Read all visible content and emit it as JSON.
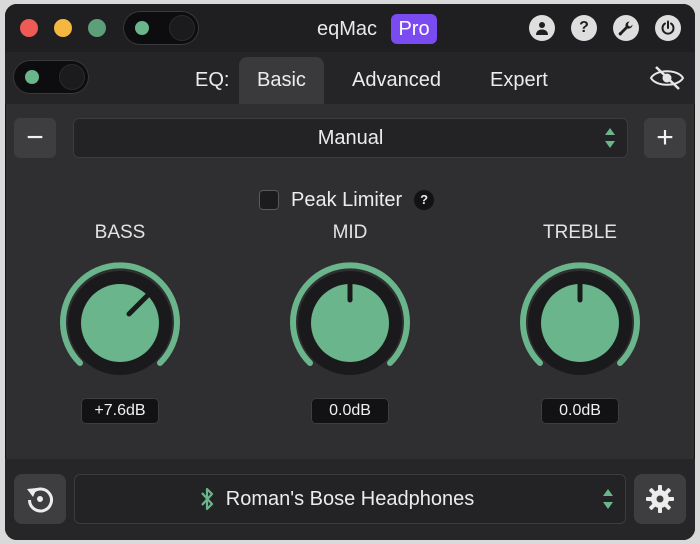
{
  "window": {
    "title": "eqMac",
    "badge": "Pro"
  },
  "titlebar": {
    "icons": [
      "user-icon",
      "question-icon",
      "wrench-icon",
      "power-icon"
    ],
    "help_label": "?"
  },
  "tabs": {
    "eq_label": "EQ:",
    "items": [
      {
        "label": "Basic",
        "active": true
      },
      {
        "label": "Advanced",
        "active": false
      },
      {
        "label": "Expert",
        "active": false
      }
    ]
  },
  "preset": {
    "remove_label": "−",
    "selected": "Manual",
    "add_label": "+"
  },
  "peak_limiter": {
    "label": "Peak Limiter",
    "checked": false,
    "help_label": "?"
  },
  "knobs": [
    {
      "name": "BASS",
      "value_label": "+7.6dB",
      "value_db": 7.6
    },
    {
      "name": "MID",
      "value_label": "0.0dB",
      "value_db": 0.0
    },
    {
      "name": "TREBLE",
      "value_label": "0.0dB",
      "value_db": 0.0
    }
  ],
  "output": {
    "device": "Roman's Bose Headphones",
    "icon": "bluetooth-icon"
  },
  "colors": {
    "accent": "#6ab58b",
    "pro_badge": "#7a4bf1",
    "close": "#ee5b56",
    "minimize": "#f4b841",
    "maximize": "#5c9f78"
  }
}
